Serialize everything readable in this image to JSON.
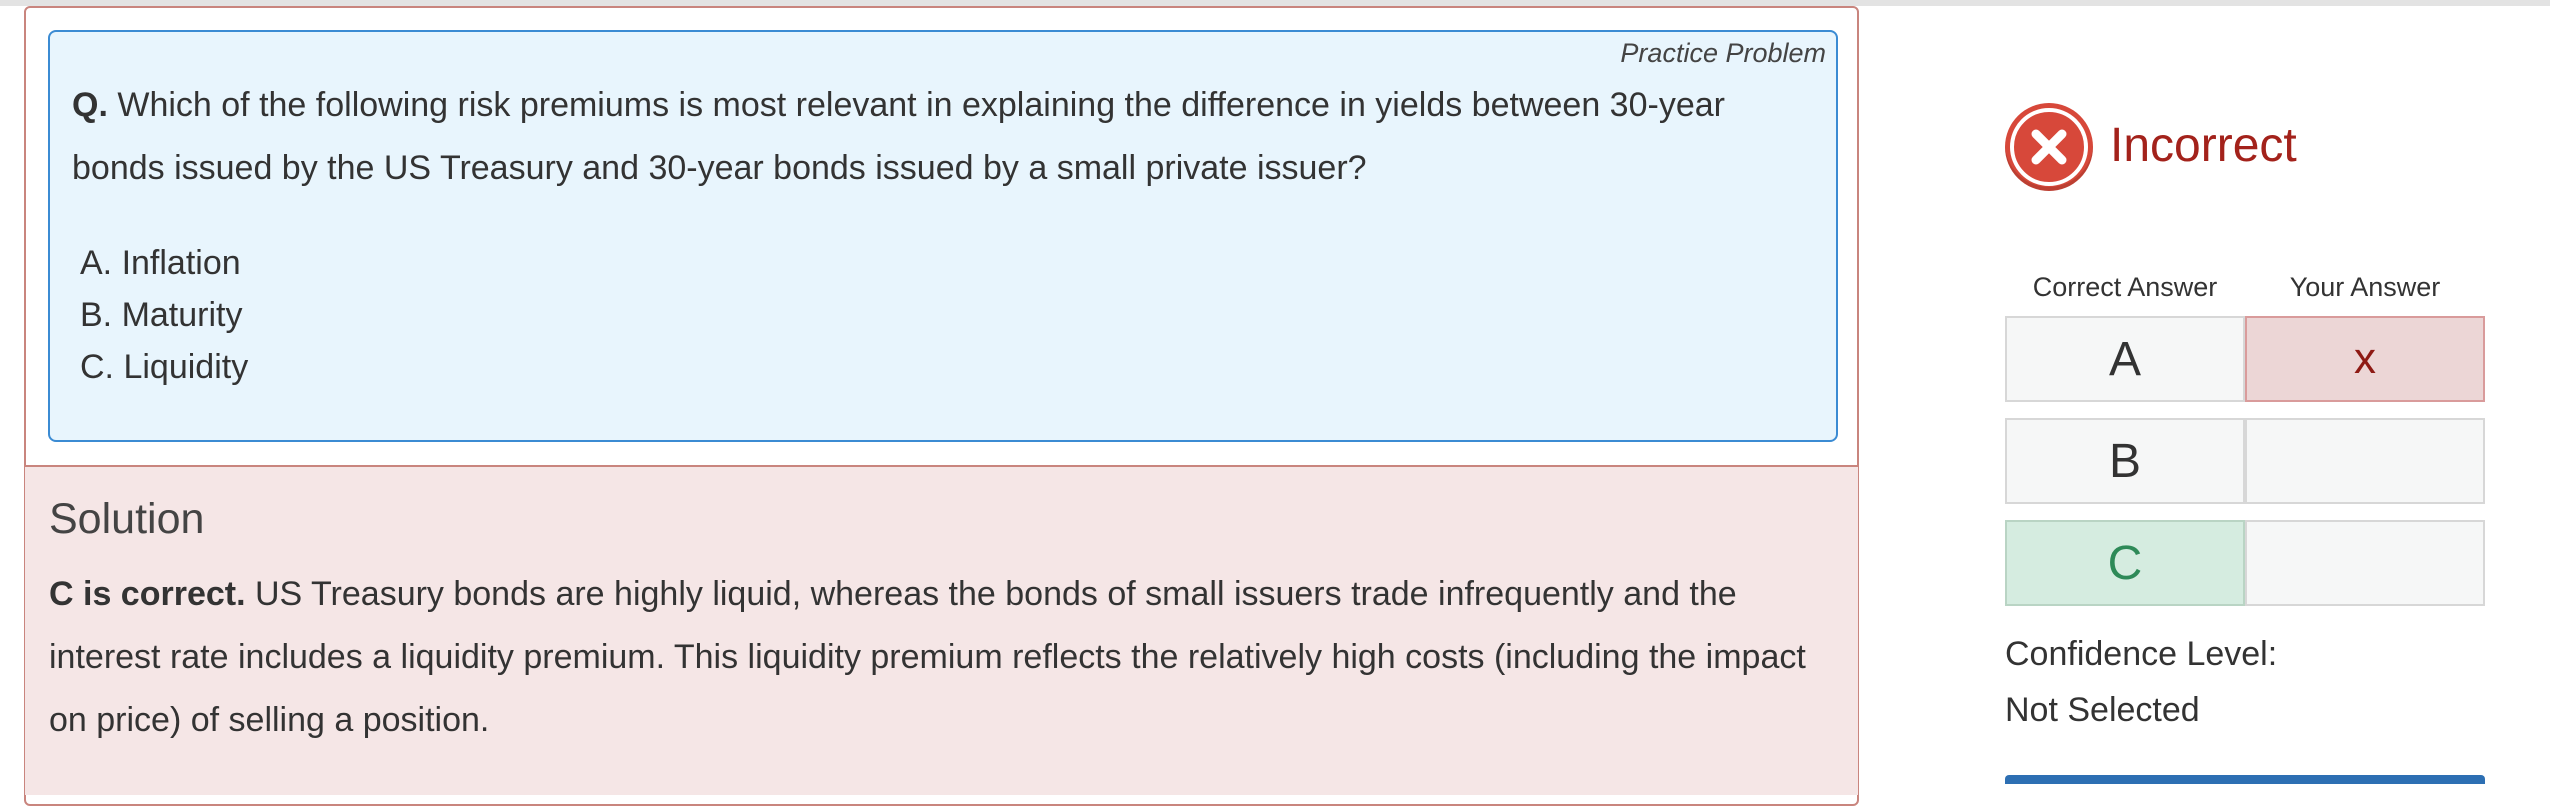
{
  "question": {
    "practice_label": "Practice Problem",
    "prefix": "Q.",
    "text": "Which of the following risk premiums is most relevant in explaining the difference in yields between 30-year bonds issued by the US Treasury and 30-year bonds issued by a small private issuer?",
    "options": [
      "A. Inflation",
      "B. Maturity",
      "C. Liquidity"
    ]
  },
  "solution": {
    "title": "Solution",
    "lead": "C is correct.",
    "text": " US Treasury bonds are highly liquid, whereas the bonds of small issuers trade infrequently and the interest rate includes a liquidity premium. This liquidity premium reflects the relatively high costs (including the impact on price) of selling a position."
  },
  "result": {
    "label": "Incorrect",
    "icon": "x-circle-icon",
    "color": "#d7483a"
  },
  "answers": {
    "correct_header": "Correct Answer",
    "yours_header": "Your Answer",
    "rows": [
      {
        "correct": "A",
        "yours": "x"
      },
      {
        "correct": "B",
        "yours": ""
      },
      {
        "correct": "C",
        "yours": ""
      }
    ]
  },
  "confidence": {
    "label": "Confidence Level:",
    "value": "Not Selected"
  }
}
